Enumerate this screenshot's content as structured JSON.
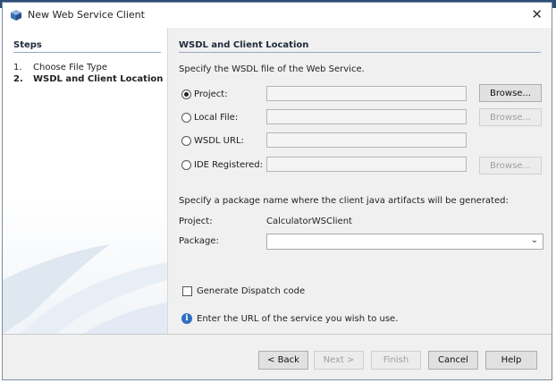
{
  "window": {
    "title": "New Web Service Client",
    "close_glyph": "✕"
  },
  "steps": {
    "heading": "Steps",
    "items": [
      {
        "num": "1.",
        "label": "Choose File Type",
        "active": false
      },
      {
        "num": "2.",
        "label": "WSDL and Client Location",
        "active": true
      }
    ]
  },
  "panel": {
    "heading": "WSDL and Client Location",
    "specify_wsdl": "Specify the WSDL file of the Web Service.",
    "sources": [
      {
        "label": "Project:",
        "value": "",
        "checked": true,
        "button": "Browse...",
        "button_enabled": true
      },
      {
        "label": "Local File:",
        "value": "",
        "checked": false,
        "button": "Browse...",
        "button_enabled": false
      },
      {
        "label": "WSDL URL:",
        "value": "",
        "checked": false
      },
      {
        "label": "IDE Registered:",
        "value": "",
        "checked": false,
        "button": "Browse...",
        "button_enabled": false
      }
    ],
    "specify_package": "Specify a package name where the client java artifacts will be generated:",
    "project_label": "Project:",
    "project_value": "CalculatorWSClient",
    "package_label": "Package:",
    "package_value": "",
    "dispatch_label": "Generate Dispatch code",
    "dispatch_checked": false,
    "info_glyph": "i",
    "info_text": "Enter the URL of the service you wish to use."
  },
  "footer": {
    "back": "< Back",
    "next": "Next >",
    "finish": "Finish",
    "cancel": "Cancel",
    "help": "Help"
  },
  "colors": {
    "accent": "#2f6fc1",
    "window_bg": "#f0f0f0"
  }
}
